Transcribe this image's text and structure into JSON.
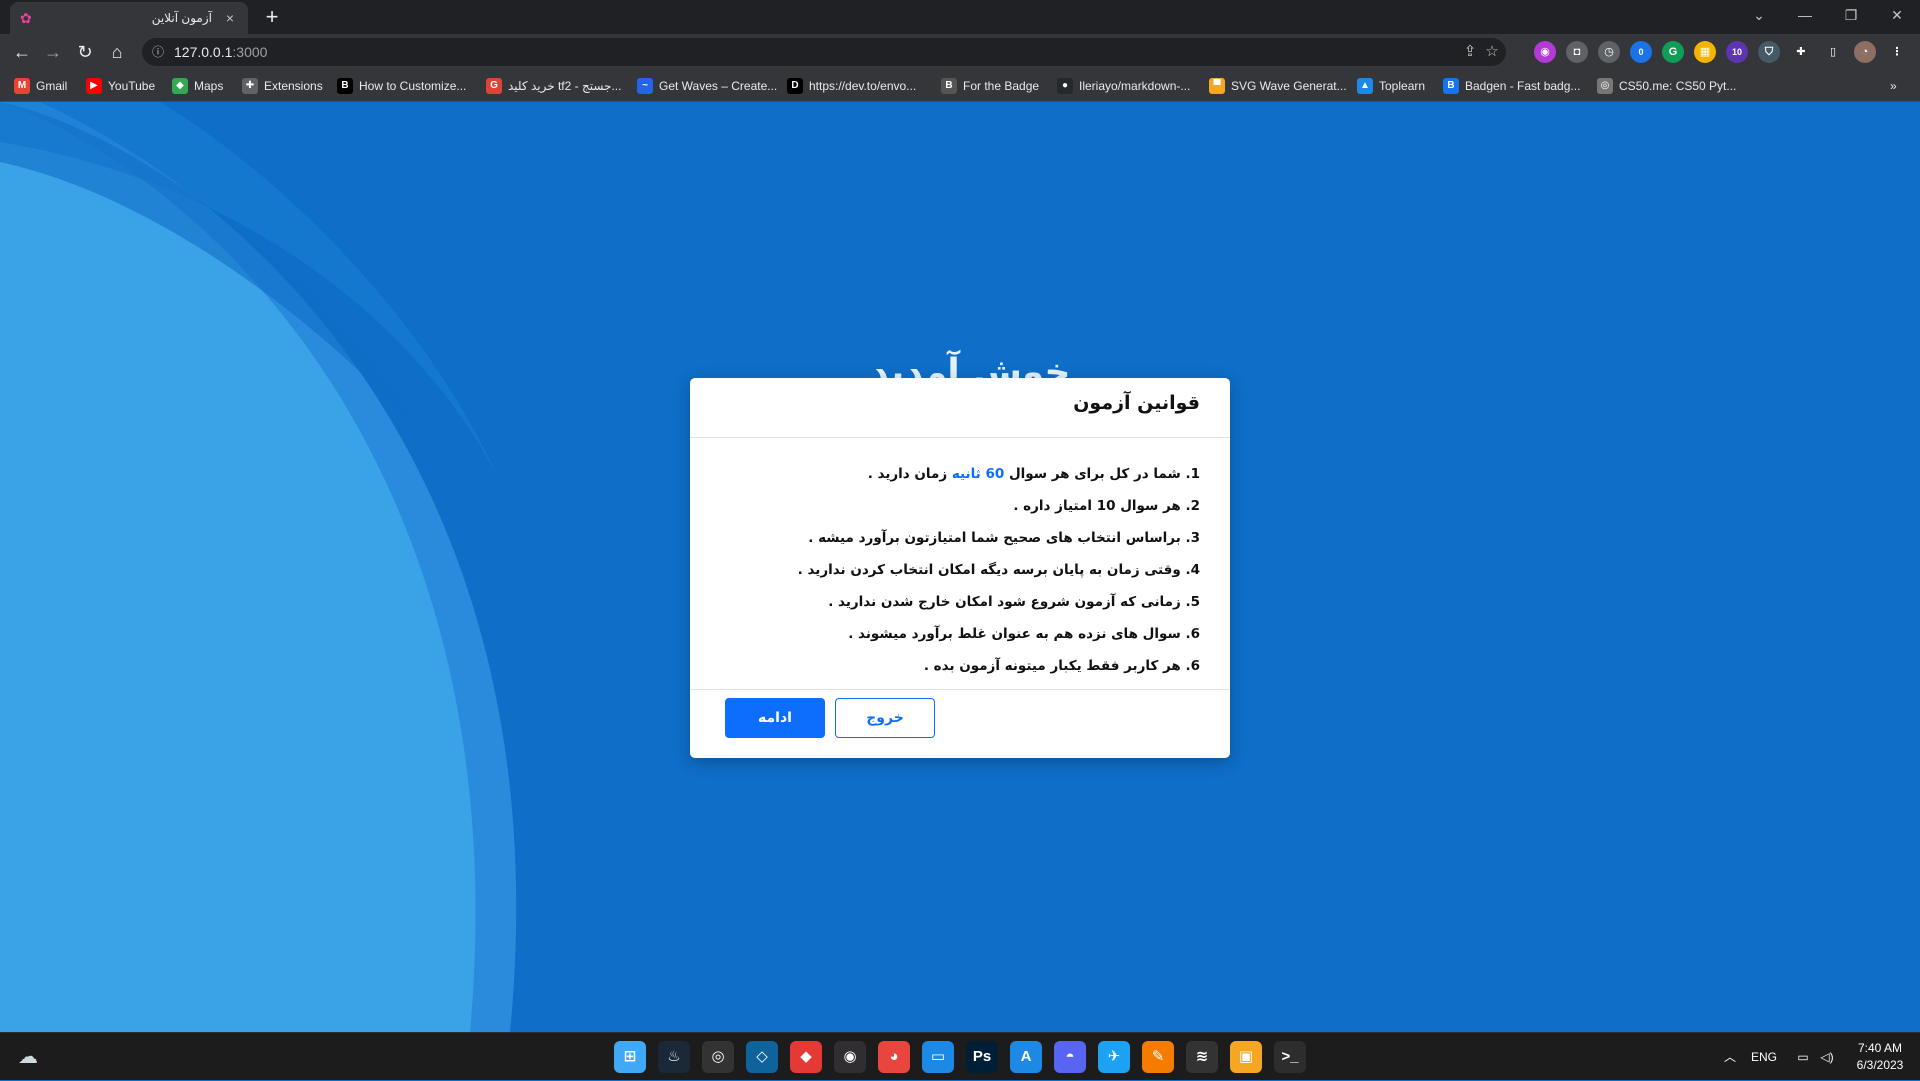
{
  "browser": {
    "tab_title": "آزمون آنلاین",
    "tab_close": "×",
    "new_tab": "+",
    "url_host": "127.0.0.1",
    "url_port": ":3000",
    "window_controls": {
      "minimize": "—",
      "restore": "❐",
      "close": "✕",
      "tab_search": "⌄"
    }
  },
  "bookmarks": [
    {
      "label": "Gmail",
      "icon": "gmail-icon",
      "color": "#ea4335",
      "glyph": "M"
    },
    {
      "label": "YouTube",
      "icon": "youtube-icon",
      "color": "#ff0000",
      "glyph": "▶"
    },
    {
      "label": "Maps",
      "icon": "maps-icon",
      "color": "#34a853",
      "glyph": "◆"
    },
    {
      "label": "Extensions",
      "icon": "puzzle-icon",
      "color": "#5f6368",
      "glyph": "✚"
    },
    {
      "label": "How to Customize...",
      "icon": "bookmark-icon",
      "color": "#000000",
      "glyph": "B"
    },
    {
      "label": "خرید کلید tf2 - جستج...",
      "icon": "google-icon",
      "color": "#db4437",
      "glyph": "G"
    },
    {
      "label": "Get Waves – Create...",
      "icon": "wave-icon",
      "color": "#2563eb",
      "glyph": "~"
    },
    {
      "label": "https://dev.to/envo...",
      "icon": "dev-icon",
      "color": "#000000",
      "glyph": "D"
    },
    {
      "label": "For the Badge",
      "icon": "badge-icon",
      "color": "#555555",
      "glyph": "B"
    },
    {
      "label": "Ileriayo/markdown-...",
      "icon": "github-icon",
      "color": "#24292e",
      "glyph": "●"
    },
    {
      "label": "SVG Wave Generat...",
      "icon": "svg-wave-icon",
      "color": "#f5a623",
      "glyph": "▀"
    },
    {
      "label": "Toplearn",
      "icon": "toplearn-icon",
      "color": "#1e88e5",
      "glyph": "▲"
    },
    {
      "label": "Badgen - Fast badg...",
      "icon": "badgen-icon",
      "color": "#1a73e8",
      "glyph": "B"
    },
    {
      "label": "CS50.me: CS50 Pyt...",
      "icon": "cs50-icon",
      "color": "#777777",
      "glyph": "◎"
    }
  ],
  "extension_badges": {
    "badge_a": "0",
    "badge_b": "10"
  },
  "page": {
    "welcome_text": "خوش آمدید",
    "modal": {
      "title": "قوانین آزمون",
      "rules": [
        {
          "before": "1. شما در کل برای هر سوال ",
          "highlight": "60 ثانیه",
          "after": " زمان دارید ."
        },
        {
          "before": "2. هر سوال 10 امتیاز داره .",
          "highlight": "",
          "after": ""
        },
        {
          "before": "3. براساس انتخاب های صحیح شما امتیازتون برآورد میشه .",
          "highlight": "",
          "after": ""
        },
        {
          "before": "4. وقتی زمان به پایان برسه دیگه امکان انتخاب کردن ندارید .",
          "highlight": "",
          "after": ""
        },
        {
          "before": "5. زمانی که آزمون شروع شود امکان خارج شدن ندارید .",
          "highlight": "",
          "after": ""
        },
        {
          "before": "6. سوال های نزده هم به عنوان غلط برآورد میشوند .",
          "highlight": "",
          "after": ""
        },
        {
          "before": "6. هر کاربر فقط یکبار میتونه آزمون بده .",
          "highlight": "",
          "after": ""
        }
      ],
      "continue_label": "ادامه",
      "exit_label": "خروج"
    },
    "colors": {
      "background": "#0e6ec8",
      "wave_light": "#3aa3e8",
      "wave_mid": "#2a8bdc",
      "primary": "#0d6efd"
    }
  },
  "taskbar": {
    "apps": [
      {
        "name": "windows-start-icon",
        "glyph": "⊞",
        "color": "#3fa9f5"
      },
      {
        "name": "steam-icon",
        "glyph": "♨",
        "color": "#1b2838"
      },
      {
        "name": "obs-ring-icon",
        "glyph": "◎",
        "color": "#333333"
      },
      {
        "name": "vscode-icon",
        "glyph": "◇",
        "color": "#0e639c"
      },
      {
        "name": "git-client-icon",
        "glyph": "◆",
        "color": "#e53935"
      },
      {
        "name": "obs-icon",
        "glyph": "◉",
        "color": "#302e31"
      },
      {
        "name": "chrome-icon",
        "glyph": "◕",
        "color": "#e8453c"
      },
      {
        "name": "desktop-icon",
        "glyph": "▭",
        "color": "#1e88e5"
      },
      {
        "name": "photoshop-icon",
        "glyph": "Ps",
        "color": "#001e36"
      },
      {
        "name": "app-store-icon",
        "glyph": "A",
        "color": "#1e88e5"
      },
      {
        "name": "discord-icon",
        "glyph": "◓",
        "color": "#5865f2"
      },
      {
        "name": "bird-app-icon",
        "glyph": "✈",
        "color": "#1da1f2"
      },
      {
        "name": "brush-app-icon",
        "glyph": "✎",
        "color": "#f57c00"
      },
      {
        "name": "network-app-icon",
        "glyph": "≋",
        "color": "#333333"
      },
      {
        "name": "virtualbox-icon",
        "glyph": "▣",
        "color": "#f5a623"
      },
      {
        "name": "terminal-icon",
        "glyph": ">_",
        "color": "#2d2d2d"
      }
    ],
    "language": "ENG",
    "time": "7:40 AM",
    "date": "6/3/2023"
  }
}
